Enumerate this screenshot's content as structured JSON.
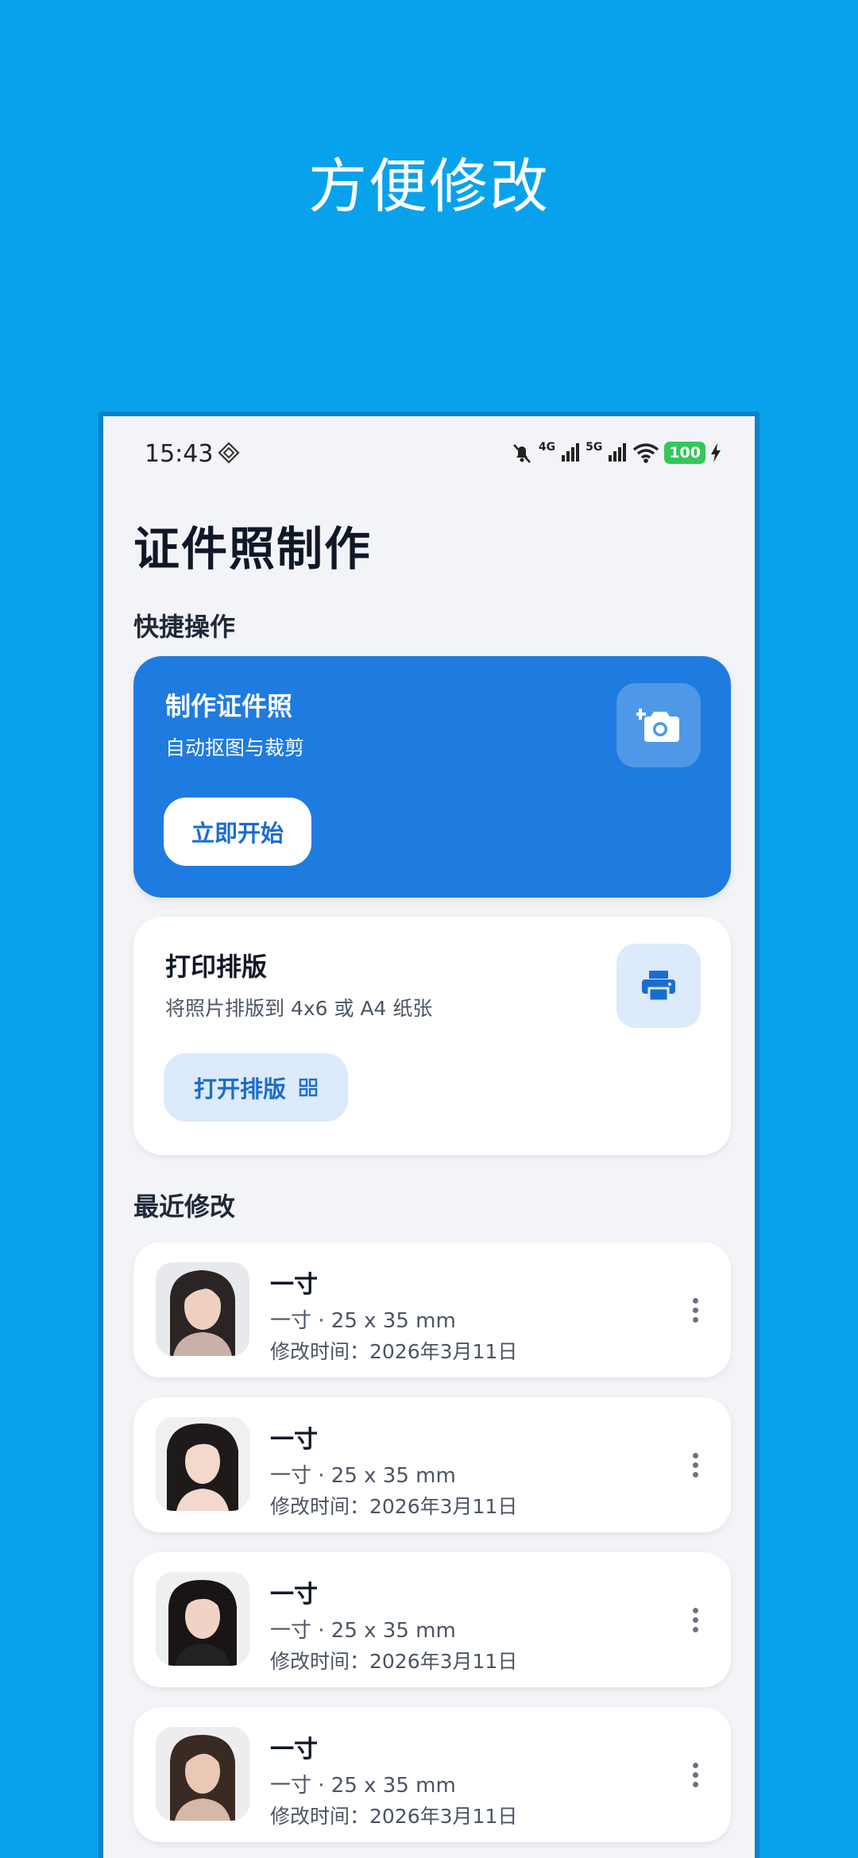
{
  "promo": {
    "title": "方便修改"
  },
  "status_bar": {
    "time": "15:43",
    "battery": "100",
    "net1": "4G",
    "net2": "5G"
  },
  "app": {
    "title": "证件照制作"
  },
  "quick_actions": {
    "label": "快捷操作",
    "make_card": {
      "title": "制作证件照",
      "subtitle": "自动抠图与裁剪",
      "button": "立即开始",
      "icon": "add-camera-icon",
      "color": "#1E7BE0"
    },
    "print_card": {
      "title": "打印排版",
      "subtitle": "将照片排版到 4x6 或 A4 纸张",
      "button": "打开排版",
      "icon": "printer-icon"
    }
  },
  "recent": {
    "label": "最近修改",
    "items": [
      {
        "title": "一寸",
        "spec": "一寸 · 25 x 35 mm",
        "date": "修改时间：2026年3月11日"
      },
      {
        "title": "一寸",
        "spec": "一寸 · 25 x 35 mm",
        "date": "修改时间：2026年3月11日"
      },
      {
        "title": "一寸",
        "spec": "一寸 · 25 x 35 mm",
        "date": "修改时间：2026年3月11日"
      },
      {
        "title": "一寸",
        "spec": "一寸 · 25 x 35 mm",
        "date": "修改时间：2026年3月11日"
      }
    ]
  },
  "colors": {
    "background": "#08A2EC",
    "accent": "#1E7BE0",
    "surface": "#F2F4F7"
  }
}
